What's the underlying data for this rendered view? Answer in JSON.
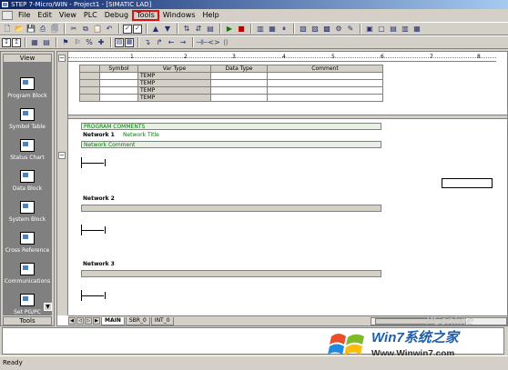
{
  "window": {
    "title": "STEP 7-Micro/WIN - Project1 - [SIMATIC LAD]"
  },
  "menu": [
    "File",
    "Edit",
    "View",
    "PLC",
    "Debug",
    "Tools",
    "Windows",
    "Help"
  ],
  "highlighted_menu": "Tools",
  "highlight_color": "#e01010",
  "toolbar1": [
    "new-icon",
    "open-icon",
    "save-icon",
    "print-icon",
    "preview-icon",
    "cut-icon",
    "copy-icon",
    "paste-icon",
    "undo-icon",
    "compile-icon",
    "compile-all-icon",
    "upload-icon",
    "download-icon",
    "sort-asc-icon",
    "sort-desc-icon",
    "options-icon",
    "run-icon",
    "stop-icon",
    "program-status-icon",
    "chart-status-icon",
    "pause-icon",
    "trend-icon",
    "force-icon",
    "unforce-icon",
    "read-all-icon",
    "write-icon",
    "single-read-icon",
    "execute-scan-icon"
  ],
  "toolbar2": [
    "insert-network-icon",
    "delete-network-icon",
    "toggle-bookmark-icon",
    "next-bookmark-icon",
    "prev-bookmark-icon",
    "remove-bookmark-icon",
    "symbol-addressing-icon",
    "poe-comments-icon",
    "network-comments-icon",
    "line-down-icon",
    "line-up-icon",
    "line-left-icon",
    "line-right-icon",
    "contact-icon",
    "coil-icon",
    "box-icon"
  ],
  "navbar": {
    "header": "View",
    "footer": "Tools",
    "items": [
      {
        "label": "Program Block"
      },
      {
        "label": "Symbol Table"
      },
      {
        "label": "Status Chart"
      },
      {
        "label": "Data Block"
      },
      {
        "label": "System Block"
      },
      {
        "label": "Cross Reference"
      },
      {
        "label": "Communications"
      },
      {
        "label": "Set PG/PC Interface"
      }
    ]
  },
  "ruler_ticks": [
    "1",
    "2",
    "3",
    "4",
    "5",
    "6",
    "7",
    "8"
  ],
  "var_table": {
    "headers": [
      "",
      "Symbol",
      "Var Type",
      "Data Type",
      "Comment"
    ],
    "rows": [
      [
        "",
        "",
        "TEMP",
        "",
        ""
      ],
      [
        "",
        "",
        "TEMP",
        "",
        ""
      ],
      [
        "",
        "",
        "TEMP",
        "",
        ""
      ],
      [
        "",
        "",
        "TEMP",
        "",
        ""
      ]
    ]
  },
  "program": {
    "program_comments": "PROGRAM COMMENTS",
    "networks": [
      {
        "label": "Network 1",
        "title": "Network Title",
        "comment": "Network Comment"
      },
      {
        "label": "Network 2",
        "title": "",
        "comment": ""
      },
      {
        "label": "Network 3",
        "title": "",
        "comment": ""
      }
    ]
  },
  "tabs": [
    "MAIN",
    "SBR_0",
    "INT_0"
  ],
  "active_tab": "MAIN",
  "status": "Ready",
  "watermark": {
    "brand": "PConline",
    "site_name": "Win7系统之家",
    "url": "Www.Winwin7.com"
  }
}
